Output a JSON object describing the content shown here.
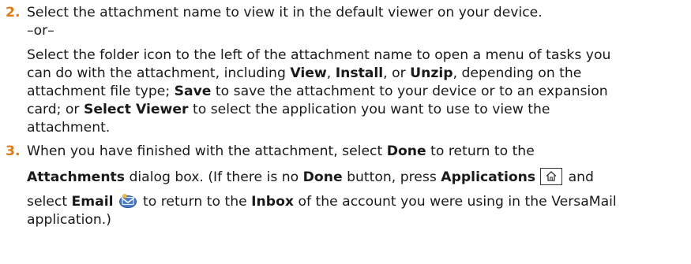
{
  "step2": {
    "number": "2.",
    "line1": "Select the attachment name to view it in the default viewer on your device.",
    "or": "–or–",
    "line3": "Select the folder icon to the left of the attachment name to open a menu of tasks you",
    "line4": "can do with the attachment, including ",
    "view": "View",
    "comma1": ", ",
    "install": "Install",
    "comma2": ", or ",
    "unzip": "Unzip",
    "line4_end": ", depending on the",
    "line5_a": "attachment file type; ",
    "save": "Save",
    "line5_b": " to save the attachment to your device or to an expansion",
    "line6_a": "card; or ",
    "select_viewer": "Select Viewer",
    "line6_b": " to select the application you want to use to view the",
    "line7": "attachment."
  },
  "step3": {
    "number": "3.",
    "line1_a": "When you have finished with the attachment, select ",
    "done": "Done",
    "line1_b": " to return to the",
    "attachments": "Attachments",
    "line2_a": " dialog box. (If there is no ",
    "done2": "Done",
    "line2_b": " button, press ",
    "applications": "Applications",
    "line2_c": " and",
    "line3_a": "select ",
    "email": "Email",
    "line3_b": " to return to the ",
    "inbox": "Inbox",
    "line3_c": " of the account you were using in the VersaMail",
    "line4": "application.)"
  },
  "icons": {
    "applications_key": "home-key-icon",
    "email_app": "email-app-icon"
  },
  "colors": {
    "step_number": "#e07a16",
    "text": "#1a1a1a"
  }
}
